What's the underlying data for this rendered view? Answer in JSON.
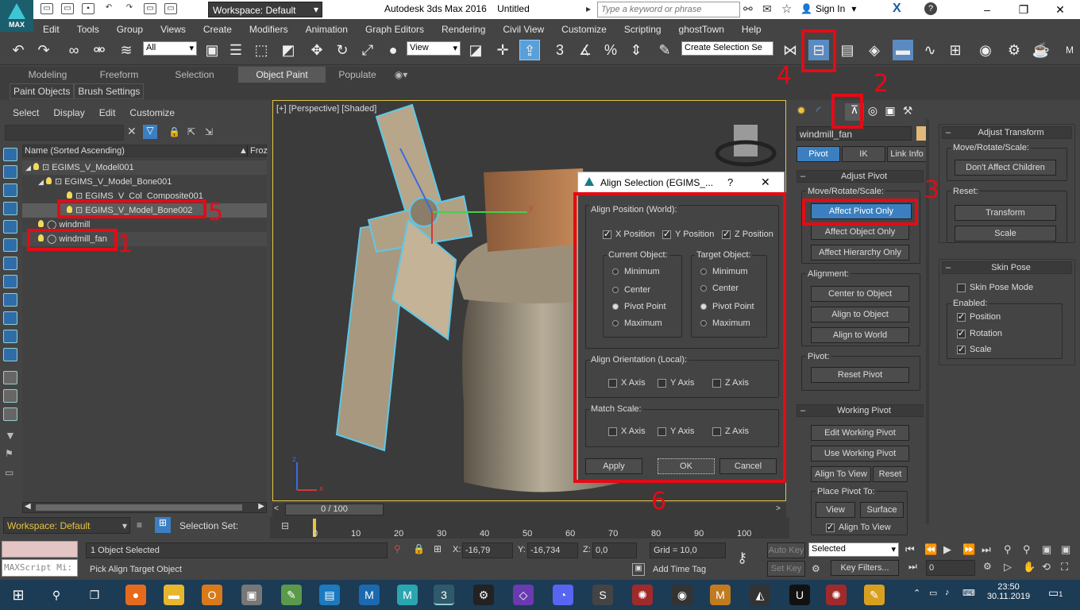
{
  "title_bar": {
    "workspace": "Workspace: Default",
    "app_title": "Autodesk 3ds Max 2016",
    "doc_title": "Untitled",
    "search_placeholder": "Type a keyword or phrase",
    "sign_in": "Sign In",
    "logo": "MAX"
  },
  "menu": [
    "Edit",
    "Tools",
    "Group",
    "Views",
    "Create",
    "Modifiers",
    "Animation",
    "Graph Editors",
    "Rendering",
    "Civil View",
    "Customize",
    "Scripting",
    "ghostTown",
    "Help"
  ],
  "toolbar": {
    "filter": "All",
    "view": "View",
    "selection_set": "Create Selection Se"
  },
  "ribbon_tabs": [
    "Modeling",
    "Freeform",
    "Selection",
    "Object Paint",
    "Populate"
  ],
  "ribbon_sub": [
    "Paint Objects",
    "Brush Settings"
  ],
  "explorer": {
    "tabs": [
      "Select",
      "Display",
      "Edit",
      "Customize"
    ],
    "col_name": "Name (Sorted Ascending)",
    "col_frozen": "Froz",
    "rows": [
      "EGIMS_V_Model001",
      "EGIMS_V_Model_Bone001",
      "EGIMS_V_Col_Composite001",
      "EGIMS_V_Model_Bone002",
      "windmill",
      "windmill_fan"
    ],
    "workspace": "Workspace: Default",
    "selection_set": "Selection Set:"
  },
  "viewport": {
    "label": "[+] [Perspective] [Shaded]",
    "axis_y": "y",
    "axis_z": "z",
    "axis_x": "x"
  },
  "dialog": {
    "title": "Align Selection (EGIMS_...",
    "help": "?",
    "close": "✕",
    "align_position": "Align Position (World):",
    "x_pos": "X Position",
    "y_pos": "Y Position",
    "z_pos": "Z Position",
    "current": "Current Object:",
    "target": "Target Object:",
    "opts": [
      "Minimum",
      "Center",
      "Pivot Point",
      "Maximum"
    ],
    "orient": "Align Orientation (Local):",
    "scale": "Match Scale:",
    "x_axis": "X Axis",
    "y_axis": "Y Axis",
    "z_axis": "Z Axis",
    "apply": "Apply",
    "ok": "OK",
    "cancel": "Cancel"
  },
  "panel": {
    "object_name": "windmill_fan",
    "tabs": [
      "Pivot",
      "IK",
      "Link Info"
    ],
    "adjust_pivot": "Adjust Pivot",
    "move_rotate_scale": "Move/Rotate/Scale:",
    "affect_pivot": "Affect Pivot Only",
    "affect_object": "Affect Object Only",
    "affect_hierarchy": "Affect Hierarchy Only",
    "alignment": "Alignment:",
    "center_to_object": "Center to Object",
    "align_to_object": "Align to Object",
    "align_to_world": "Align to World",
    "pivot": "Pivot:",
    "reset_pivot": "Reset Pivot",
    "working_pivot": "Working Pivot",
    "edit_working": "Edit Working Pivot",
    "use_working": "Use Working Pivot",
    "align_to_view": "Align To View",
    "reset": "Reset",
    "place_pivot": "Place Pivot To:",
    "view": "View",
    "surface": "Surface",
    "align_to_view_chk": "Align To View",
    "adjust_transform": "Adjust Transform",
    "mrs2": "Move/Rotate/Scale:",
    "dont_affect": "Don't Affect Children",
    "reset2": "Reset:",
    "transform": "Transform",
    "scale_btn": "Scale",
    "skin_pose": "Skin Pose",
    "skin_pose_mode": "Skin Pose Mode",
    "enabled": "Enabled:",
    "position": "Position",
    "rotation": "Rotation",
    "scale_chk": "Scale"
  },
  "timeline": {
    "frame": "0 / 100",
    "ticks": [
      "0",
      "10",
      "20",
      "30",
      "40",
      "50",
      "60",
      "70",
      "80",
      "90",
      "100"
    ]
  },
  "status": {
    "selected": "1 Object Selected",
    "prompt": "Pick Align Target Object",
    "maxscript": "MAXScript Mi:",
    "x_label": "X:",
    "x": "-16,79",
    "y_label": "Y:",
    "y": "-16,734",
    "z_label": "Z:",
    "z": "0,0",
    "grid": "Grid = 10,0",
    "add_time_tag": "Add Time Tag",
    "auto_key": "Auto Key",
    "set_key": "Set Key",
    "selected_dd": "Selected",
    "key_filters": "Key Filters...",
    "frame_field": "0"
  },
  "taskbar": {
    "time": "23:50",
    "date": "30.11.2019",
    "notif": "1"
  },
  "annotations": [
    "1",
    "2",
    "3",
    "4",
    "5",
    "6"
  ],
  "annotation_color": "#e30b16"
}
